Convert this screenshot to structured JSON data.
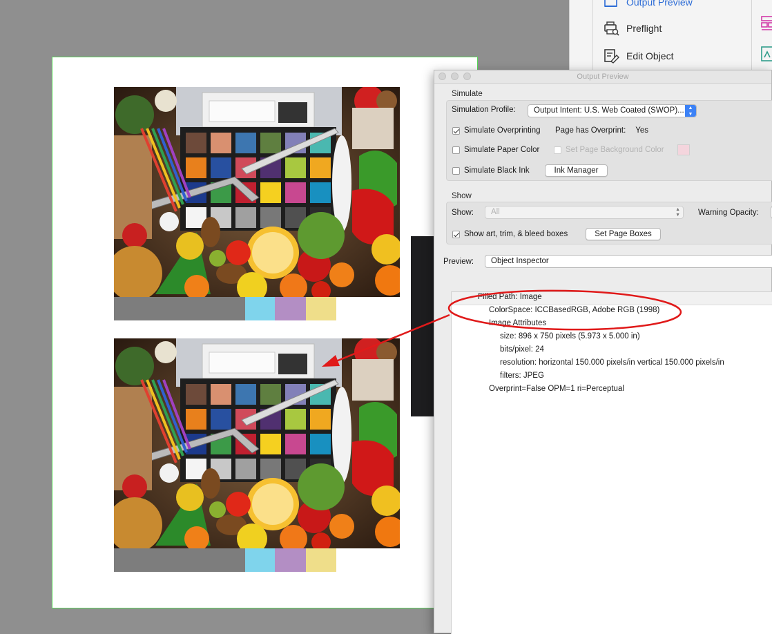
{
  "tools_panel": {
    "items": [
      {
        "label": "Output Preview",
        "icon": "output-preview-icon"
      },
      {
        "label": "Preflight",
        "icon": "preflight-icon"
      },
      {
        "label": "Edit Object",
        "icon": "edit-object-icon"
      }
    ]
  },
  "window": {
    "title": "Output Preview",
    "simulate": {
      "section_label": "Simulate",
      "profile_label": "Simulation Profile:",
      "profile_value": "Output Intent: U.S. Web Coated (SWOP)...",
      "overprinting_label": "Simulate Overprinting",
      "overprinting_checked": true,
      "has_overprint_label": "Page has Overprint:",
      "has_overprint_value": "Yes",
      "paper_color_label": "Simulate Paper Color",
      "paper_color_checked": false,
      "page_bg_label": "Set Page Background Color",
      "page_bg_swatch": "#f4d5dd",
      "black_ink_label": "Simulate Black Ink",
      "black_ink_checked": false,
      "ink_manager_button": "Ink Manager"
    },
    "show": {
      "section_label": "Show",
      "show_label": "Show:",
      "show_value": "All",
      "warning_label": "Warning Opacity:",
      "boxes_label": "Show art, trim, & bleed boxes",
      "boxes_checked": true,
      "set_boxes_button": "Set Page Boxes"
    },
    "preview": {
      "label": "Preview:",
      "value": "Object Inspector"
    },
    "inspector": {
      "lines": [
        "Filled Path: Image",
        "ColorSpace: ICCBasedRGB, Adobe RGB (1998)",
        "Image Attributes",
        "size: 896 x 750 pixels (5.973 x 5.000 in)",
        "bits/pixel: 24",
        "resolution: horizontal 150.000 pixels/in vertical 150.000 pixels/in",
        "filters: JPEG",
        "Overprint=False OPM=1 ri=Perceptual"
      ]
    }
  },
  "colors": {
    "page_border": "#57d957",
    "annotation_red": "#e01a1a",
    "strip": [
      "#7d7d7d",
      "#7fd4ec",
      "#b38ec4",
      "#efde8a"
    ]
  }
}
